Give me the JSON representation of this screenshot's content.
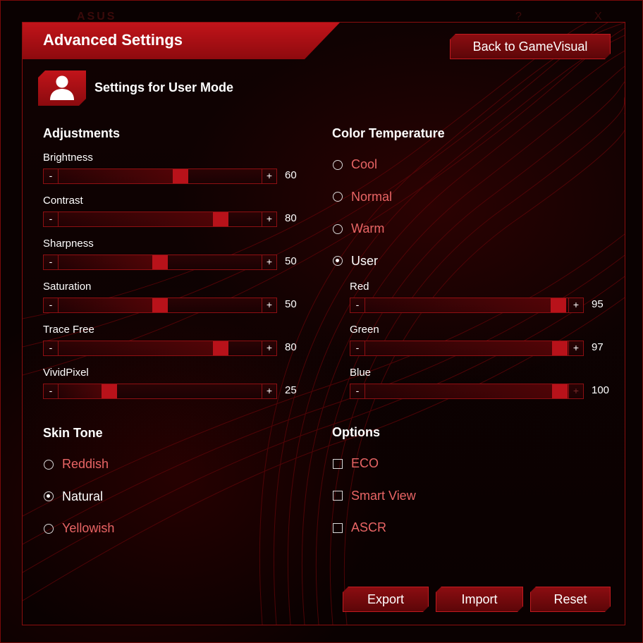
{
  "window": {
    "logo_text": "ASUS",
    "help_glyph": "?",
    "close_glyph": "X"
  },
  "header": {
    "title": "Advanced Settings",
    "back_button": "Back to GameVisual"
  },
  "mode": {
    "icon": "user-icon",
    "title": "Settings for User Mode"
  },
  "adjustments": {
    "title": "Adjustments",
    "minus": "-",
    "plus": "+",
    "sliders": [
      {
        "label": "Brightness",
        "value": "60",
        "level": 0.6
      },
      {
        "label": "Contrast",
        "value": "80",
        "level": 0.8
      },
      {
        "label": "Sharpness",
        "value": "50",
        "level": 0.5
      },
      {
        "label": "Saturation",
        "value": "50",
        "level": 0.5
      },
      {
        "label": "Trace Free",
        "value": "80",
        "level": 0.8
      },
      {
        "label": "VividPixel",
        "value": "25",
        "level": 0.25
      }
    ]
  },
  "color_temperature": {
    "title": "Color Temperature",
    "options": [
      "Cool",
      "Normal",
      "Warm",
      "User"
    ],
    "selected": "User",
    "sliders": [
      {
        "label": "Red",
        "value": "95",
        "level": 0.95
      },
      {
        "label": "Green",
        "value": "97",
        "level": 0.97
      },
      {
        "label": "Blue",
        "value": "100",
        "level": 1.0
      }
    ]
  },
  "skin_tone": {
    "title": "Skin Tone",
    "options": [
      "Reddish",
      "Natural",
      "Yellowish"
    ],
    "selected": "Natural"
  },
  "options": {
    "title": "Options",
    "items": [
      {
        "label": "ECO",
        "checked": false
      },
      {
        "label": "Smart View",
        "checked": false
      },
      {
        "label": "ASCR",
        "checked": false
      }
    ]
  },
  "actions": {
    "export": "Export",
    "import": "Import",
    "reset": "Reset"
  },
  "colors": {
    "accent": "#c2141a",
    "thumb": "#b8121a",
    "inactive_text": "#e86565",
    "border": "#8e0f12"
  }
}
